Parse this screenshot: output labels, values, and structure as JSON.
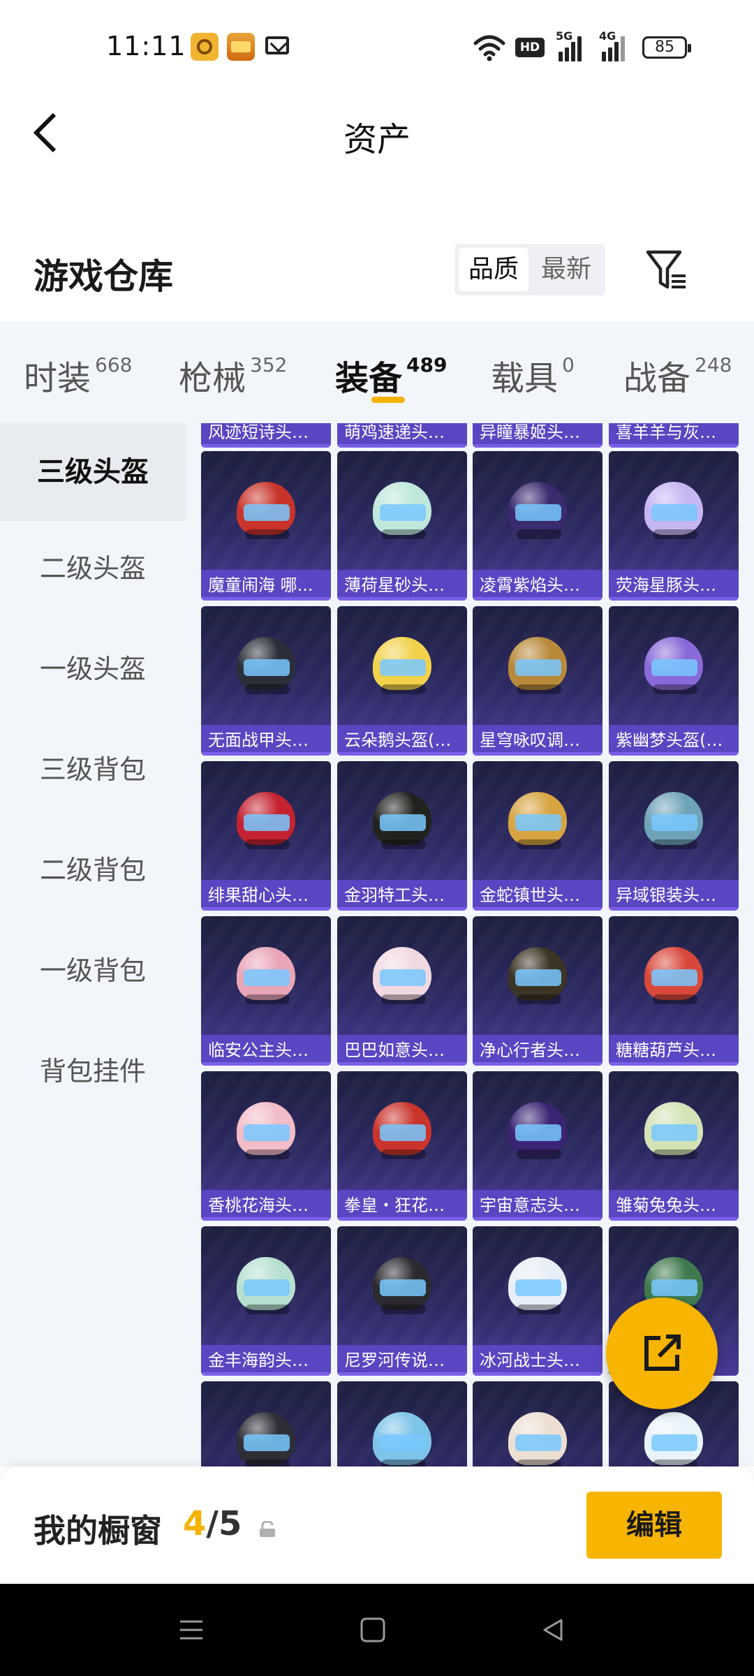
{
  "status_bar": {
    "time": "11:11",
    "network_badge": "HD",
    "signal1_label": "5G",
    "signal2_label": "4G",
    "battery": "85"
  },
  "header": {
    "title": "资产"
  },
  "section": {
    "title": "游戏仓库",
    "sort_options": [
      "品质",
      "最新"
    ],
    "active_sort": "品质"
  },
  "tabs": [
    {
      "name": "时装",
      "count": "668"
    },
    {
      "name": "枪械",
      "count": "352"
    },
    {
      "name": "装备",
      "count": "489"
    },
    {
      "name": "载具",
      "count": "0"
    },
    {
      "name": "战备",
      "count": "248"
    }
  ],
  "active_tab": "装备",
  "sidebar": {
    "items": [
      "三级头盔",
      "二级头盔",
      "一级头盔",
      "三级背包",
      "二级背包",
      "一级背包",
      "背包挂件"
    ],
    "active": "三级头盔"
  },
  "grid": {
    "top_partial_labels": [
      "风迹短诗头盔...",
      "萌鸡速递头盔...",
      "异瞳暴姬头盔...",
      "喜羊羊与灰太..."
    ],
    "items": [
      {
        "label": "魔童闹海 哪...",
        "color": "#c8332a"
      },
      {
        "label": "薄荷星砂头盔...",
        "color": "#bfe7dc"
      },
      {
        "label": "凌霄紫焰头盔...",
        "color": "#3a2a6e"
      },
      {
        "label": "荧海星豚头盔...",
        "color": "#c6b6f2"
      },
      {
        "label": "无面战甲头盔...",
        "color": "#2b2f3a"
      },
      {
        "label": "云朵鹅头盔(3...",
        "color": "#f2d24a"
      },
      {
        "label": "星穹咏叹调头...",
        "color": "#b9893a"
      },
      {
        "label": "紫幽梦头盔(3...",
        "color": "#8a6ad8"
      },
      {
        "label": "绯果甜心头盔...",
        "color": "#c42230"
      },
      {
        "label": "金羽特工头盔...",
        "color": "#22231f"
      },
      {
        "label": "金蛇镇世头盔...",
        "color": "#d7a441"
      },
      {
        "label": "异域银装头盔...",
        "color": "#6fa3b8"
      },
      {
        "label": "临安公主头盔...",
        "color": "#e9a6b8"
      },
      {
        "label": "巴巴如意头盔...",
        "color": "#f1d9e1"
      },
      {
        "label": "净心行者头盔...",
        "color": "#3c3424"
      },
      {
        "label": "糖糖葫芦头盔...",
        "color": "#d8483a"
      },
      {
        "label": "香桃花海头盔...",
        "color": "#f2bcc8"
      },
      {
        "label": "拳皇・狂花道...",
        "color": "#c9352c"
      },
      {
        "label": "宇宙意志头盔...",
        "color": "#3c2474"
      },
      {
        "label": "雏菊兔兔头盔...",
        "color": "#d3e3b6"
      },
      {
        "label": "金丰海韵头盔...",
        "color": "#b8e0d0"
      },
      {
        "label": "尼罗河传说头...",
        "color": "#2a2a30"
      },
      {
        "label": "冰河战士头盔...",
        "color": "#e8eef7"
      },
      {
        "label": "",
        "color": "#3f7a4e"
      },
      {
        "label": "",
        "color": "#2d2e36"
      },
      {
        "label": "",
        "color": "#7cc4e8"
      },
      {
        "label": "",
        "color": "#ecdfd2"
      },
      {
        "label": "",
        "color": "#e9f3fb"
      }
    ]
  },
  "showcase": {
    "label": "我的橱窗",
    "current": "4",
    "separator": "/",
    "total": "5",
    "edit_label": "编辑"
  }
}
